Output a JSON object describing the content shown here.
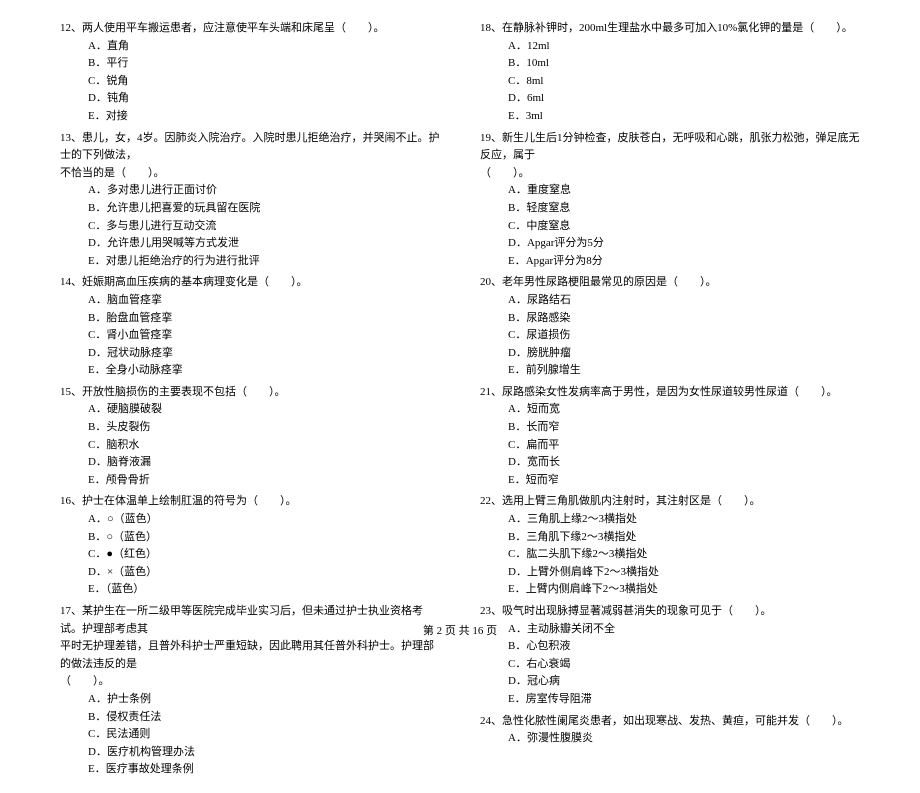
{
  "columns": {
    "left": {
      "questions": [
        {
          "num": "12",
          "text": "、两人使用平车搬运患者，应注意使平车头端和床尾呈（　　）。",
          "options": [
            "A．直角",
            "B．平行",
            "C．锐角",
            "D．钝角",
            "E．对接"
          ]
        },
        {
          "num": "13",
          "text": "、患儿，女，4岁。因肺炎入院治疗。入院时患儿拒绝治疗，并哭闹不止。护士的下列做法，",
          "continuation": "不恰当的是（　　）。",
          "options": [
            "A．多对患儿进行正面讨价",
            "B．允许患儿把喜爱的玩具留在医院",
            "C．多与患儿进行互动交流",
            "D．允许患儿用哭喊等方式发泄",
            "E．对患儿拒绝治疗的行为进行批评"
          ]
        },
        {
          "num": "14",
          "text": "、妊娠期高血压疾病的基本病理变化是（　　）。",
          "options": [
            "A．脑血管痉挛",
            "B．胎盘血管痉挛",
            "C．肾小血管痉挛",
            "D．冠状动脉痉挛",
            "E．全身小动脉痉挛"
          ]
        },
        {
          "num": "15",
          "text": "、开放性脑损伤的主要表现不包括（　　）。",
          "options": [
            "A．硬脑膜破裂",
            "B．头皮裂伤",
            "C．脑积水",
            "D．脑脊液漏",
            "E．颅骨骨折"
          ]
        },
        {
          "num": "16",
          "text": "、护士在体温单上绘制肛温的符号为（　　）。",
          "options": [
            "A．○（蓝色）",
            "B．○（蓝色）",
            "C．●（红色）",
            "D．×（蓝色）",
            "E．（蓝色）"
          ]
        },
        {
          "num": "17",
          "text": "、某护生在一所二级甲等医院完成毕业实习后，但未通过护士执业资格考试。护理部考虑其",
          "continuation": "平时无护理差错，且普外科护士严重短缺，因此聘用其任普外科护士。护理部的做法违反的是",
          "continuation2": "（　　）。",
          "options": [
            "A．护士条例",
            "B．侵权责任法",
            "C．民法通则",
            "D．医疗机构管理办法",
            "E．医疗事故处理条例"
          ]
        }
      ]
    },
    "right": {
      "questions": [
        {
          "num": "18",
          "text": "、在静脉补钾时，200ml生理盐水中最多可加入10%氯化钾的量是（　　）。",
          "options": [
            "A．12ml",
            "B．10ml",
            "C．8ml",
            "D．6ml",
            "E．3ml"
          ]
        },
        {
          "num": "19",
          "text": "、新生儿生后1分钟检查，皮肤苍白，无呼吸和心跳，肌张力松弛，弹足底无反应，属于",
          "continuation": "（　　）。",
          "options": [
            "A．重度窒息",
            "B．轻度窒息",
            "C．中度窒息",
            "D．Apgar评分为5分",
            "E．Apgar评分为8分"
          ]
        },
        {
          "num": "20",
          "text": "、老年男性尿路梗阻最常见的原因是（　　）。",
          "options": [
            "A．尿路结石",
            "B．尿路感染",
            "C．尿道损伤",
            "D．膀胱肿瘤",
            "E．前列腺增生"
          ]
        },
        {
          "num": "21",
          "text": "、尿路感染女性发病率高于男性，是因为女性尿道较男性尿道（　　）。",
          "options": [
            "A．短而宽",
            "B．长而窄",
            "C．扁而平",
            "D．宽而长",
            "E．短而窄"
          ]
        },
        {
          "num": "22",
          "text": "、选用上臂三角肌做肌内注射时，其注射区是（　　）。",
          "options": [
            "A．三角肌上缘2～3横指处",
            "B．三角肌下缘2～3横指处",
            "C．肱二头肌下缘2～3横指处",
            "D．上臂外侧肩峰下2～3横指处",
            "E．上臂内侧肩峰下2～3横指处"
          ]
        },
        {
          "num": "23",
          "text": "、吸气时出现脉搏显著减弱甚消失的现象可见于（　　）。",
          "options": [
            "A．主动脉瓣关闭不全",
            "B．心包积液",
            "C．右心衰竭",
            "D．冠心病",
            "E．房室传导阻滞"
          ]
        },
        {
          "num": "24",
          "text": "、急性化脓性阑尾炎患者，如出现寒战、发热、黄疸，可能并发（　　）。",
          "options": [
            "A．弥漫性腹膜炎"
          ]
        }
      ]
    }
  },
  "footer": "第 2 页 共 16 页"
}
